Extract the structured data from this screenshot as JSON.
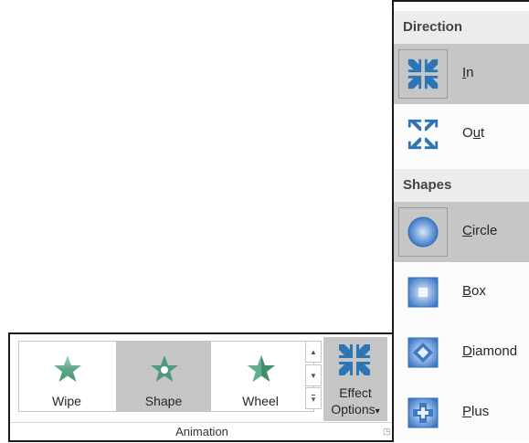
{
  "animation_group": {
    "label": "Animation",
    "gallery": [
      {
        "label": "Wipe",
        "icon": "wipe-star-icon",
        "selected": false
      },
      {
        "label": "Shape",
        "icon": "shape-star-icon",
        "selected": true
      },
      {
        "label": "Wheel",
        "icon": "wheel-star-icon",
        "selected": false
      }
    ],
    "effect_options": {
      "line1": "Effect",
      "line2": "Options",
      "caret": "▾",
      "icon": "shrink-in-icon"
    },
    "scroll_up": "▲",
    "scroll_down": "▼",
    "more": "▾"
  },
  "menu": {
    "direction_header": "Direction",
    "shapes_header": "Shapes",
    "direction_items": [
      {
        "pre": "",
        "ul": "I",
        "post": "n",
        "icon": "arrows-in-icon",
        "selected": true
      },
      {
        "pre": "O",
        "ul": "u",
        "post": "t",
        "icon": "arrows-out-icon",
        "selected": false
      }
    ],
    "shape_items": [
      {
        "pre": "",
        "ul": "C",
        "post": "ircle",
        "icon": "circle-shape-icon",
        "selected": true
      },
      {
        "pre": "",
        "ul": "B",
        "post": "ox",
        "icon": "box-shape-icon",
        "selected": false
      },
      {
        "pre": "",
        "ul": "D",
        "post": "iamond",
        "icon": "diamond-shape-icon",
        "selected": false
      },
      {
        "pre": "",
        "ul": "P",
        "post": "lus",
        "icon": "plus-shape-icon",
        "selected": false
      }
    ]
  },
  "colors": {
    "accent_blue": "#2e75b6",
    "star_green": "#4e9a7c",
    "selected_gray": "#c6c6c6"
  }
}
